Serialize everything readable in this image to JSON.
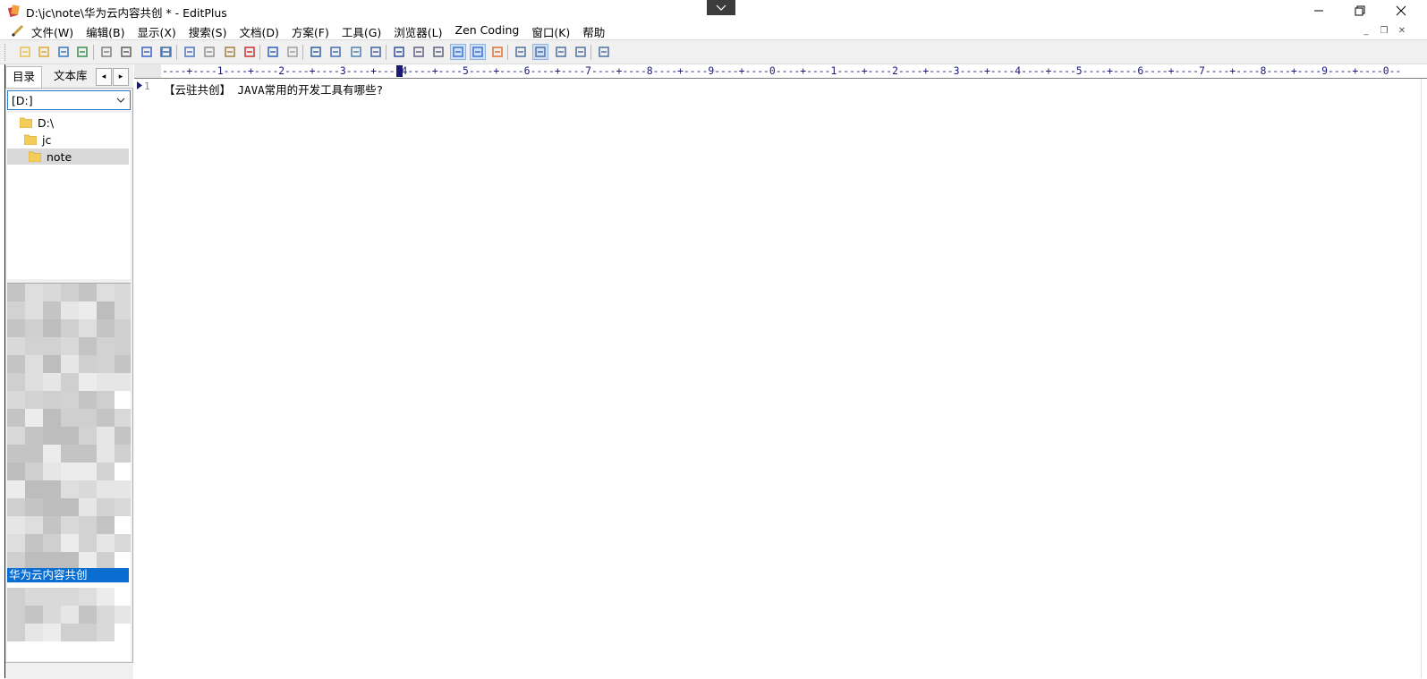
{
  "window": {
    "title": "D:\\jc\\note\\华为云内容共创 * - EditPlus",
    "minimize_label": "─",
    "restore_label": "❐",
    "close_label": "✕"
  },
  "menu": {
    "items": [
      "文件(W)",
      "编辑(B)",
      "显示(X)",
      "搜索(S)",
      "文档(D)",
      "方案(F)",
      "工具(G)",
      "浏览器(L)",
      "Zen Coding",
      "窗口(K)",
      "帮助"
    ],
    "mdi_min": "_",
    "mdi_restore": "❐",
    "mdi_close": "✕"
  },
  "toolbar": {
    "icons": [
      "new-file-icon",
      "open-folder-icon",
      "save-icon",
      "save-all-icon",
      "print-preview-icon",
      "print-icon",
      "spellcheck-icon",
      "spellcheck2-icon",
      "browser-preview-icon",
      "cut-icon",
      "copy-icon",
      "paste-icon",
      "delete-icon",
      "undo-icon",
      "redo-icon",
      "find-icon",
      "replace-icon",
      "find-in-files-icon",
      "goto-icon",
      "font-icon",
      "hx-icon",
      "html-toolbar-icon",
      "word-wrap-icon",
      "column-select-icon",
      "check-icon",
      "directory-window-icon",
      "cliptext-window-icon",
      "output-window-icon",
      "full-screen-icon",
      "help-icon"
    ]
  },
  "left_panel": {
    "tab_directory": "目录",
    "tab_cliptext": "文本库",
    "prev_arrow": "◂",
    "next_arrow": "▸",
    "drive": "[D:]",
    "tree": [
      {
        "label": "D:\\",
        "indent": 0
      },
      {
        "label": "jc",
        "indent": 1
      },
      {
        "label": "note",
        "indent": 2,
        "selected": true
      }
    ],
    "selected_file": "华为云内容共创"
  },
  "editor": {
    "ruler": "----+----1----+----2----+----3----+----4----+----5----+----6----+----7----+----8----+----9----+----0----+----1----+----2----+----3----+----4----+----5----+----6----+----7----+----8----+----9----+----0--",
    "line_numbers": [
      "1"
    ],
    "lines": [
      "【云驻共创】 JAVA常用的开发工具有哪些?"
    ]
  },
  "colors": {
    "selection": "#0a6ed1",
    "ruler_text": "#1a1a7a",
    "toolbar_bg": "#f0f0f0"
  }
}
